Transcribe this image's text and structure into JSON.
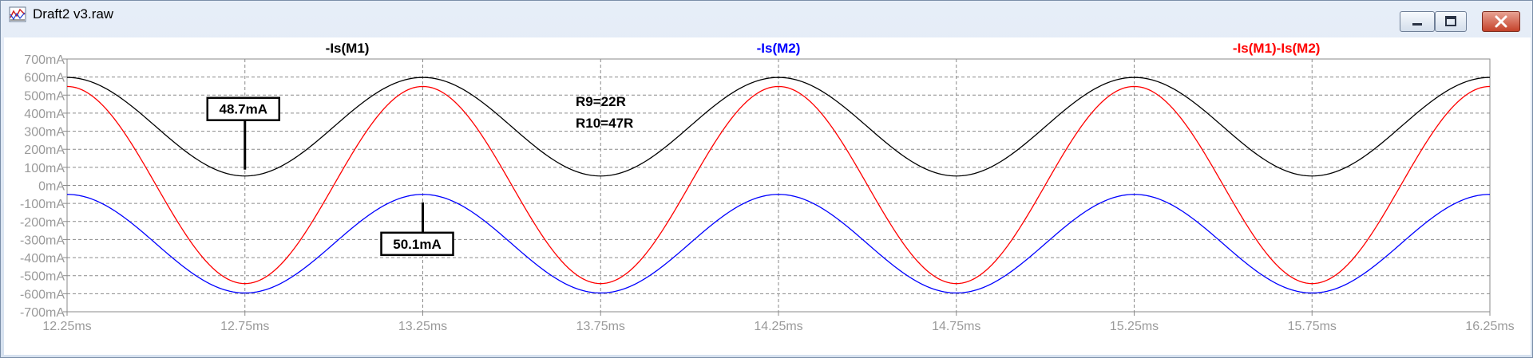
{
  "window": {
    "title": "Draft2 v3.raw",
    "app_icon": "waveform-viewer-icon",
    "buttons": {
      "minimize_icon": "minimize-icon",
      "maximize_icon": "maximize-icon",
      "close_icon": "close-icon"
    }
  },
  "chart_data": {
    "type": "line",
    "xunit": "ms",
    "yunit": "mA",
    "xlim": [
      12.25,
      16.25
    ],
    "ylim": [
      -700,
      700
    ],
    "x_ticks": [
      12.25,
      12.75,
      13.25,
      13.75,
      14.25,
      14.75,
      15.25,
      15.75,
      16.25
    ],
    "x_tick_labels": [
      "12.25ms",
      "12.75ms",
      "13.25ms",
      "13.75ms",
      "14.25ms",
      "14.75ms",
      "15.25ms",
      "15.75ms",
      "16.25ms"
    ],
    "y_ticks": [
      700,
      600,
      500,
      400,
      300,
      200,
      100,
      0,
      -100,
      -200,
      -300,
      -400,
      -500,
      -600,
      -700
    ],
    "y_tick_labels": [
      "700mA",
      "600mA",
      "500mA",
      "400mA",
      "300mA",
      "200mA",
      "100mA",
      "0mA",
      "-100mA",
      "-200mA",
      "-300mA",
      "-400mA",
      "-500mA",
      "-600mA",
      "-700mA"
    ],
    "grid": true,
    "series": [
      {
        "name": "-Is(M1)",
        "color": "#000000",
        "x": [
          12.25,
          12.5,
          12.75,
          13.0,
          13.25,
          13.5,
          13.75,
          14.0,
          14.25,
          14.5,
          14.75,
          15.0,
          15.25,
          15.5,
          15.75,
          16.0,
          16.25
        ],
        "y": [
          598,
          325,
          52,
          325,
          598,
          325,
          52,
          325,
          598,
          325,
          52,
          325,
          598,
          325,
          52,
          325,
          598
        ]
      },
      {
        "name": "-Is(M2)",
        "color": "#0000ff",
        "x": [
          12.25,
          12.5,
          12.75,
          13.0,
          13.25,
          13.5,
          13.75,
          14.0,
          14.25,
          14.5,
          14.75,
          15.0,
          15.25,
          15.5,
          15.75,
          16.0,
          16.25
        ],
        "y": [
          -50,
          -323,
          -596,
          -323,
          -50,
          -323,
          -596,
          -323,
          -50,
          -323,
          -596,
          -323,
          -50,
          -323,
          -596,
          -323,
          -50
        ]
      },
      {
        "name": "-Is(M1)-Is(M2)",
        "color": "#ff0000",
        "x": [
          12.25,
          12.5,
          12.75,
          13.0,
          13.25,
          13.5,
          13.75,
          14.0,
          14.25,
          14.5,
          14.75,
          15.0,
          15.25,
          15.5,
          15.75,
          16.0,
          16.25
        ],
        "y": [
          548,
          2,
          -544,
          2,
          548,
          2,
          -544,
          2,
          548,
          2,
          -544,
          2,
          548,
          2,
          -544,
          2,
          548
        ]
      }
    ],
    "annotations": [
      {
        "text": "48.7mA",
        "points_to": [
          12.75,
          52
        ]
      },
      {
        "text": "50.1mA",
        "points_to": [
          13.25,
          -50
        ]
      }
    ],
    "notes": [
      "R9=22R",
      "R10=47R"
    ]
  }
}
